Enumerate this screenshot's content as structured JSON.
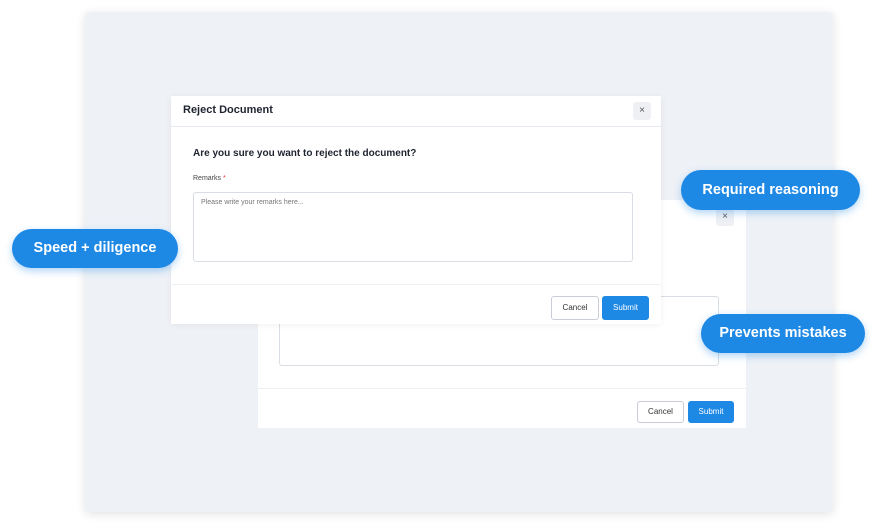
{
  "back_modal": {
    "cancel_label": "Cancel",
    "submit_label": "Submit",
    "close_glyph": "×"
  },
  "modal": {
    "title": "Reject Document",
    "close_glyph": "×",
    "question": "Are you sure you want to reject the document?",
    "remarks_label": "Remarks",
    "required_marker": "*",
    "remarks_placeholder": "Please write your remarks here...",
    "remarks_value": "",
    "cancel_label": "Cancel",
    "submit_label": "Submit"
  },
  "callouts": {
    "speed": "Speed + diligence",
    "required": "Required reasoning",
    "prevents": "Prevents mistakes"
  },
  "colors": {
    "accent": "#1e88e5",
    "panel_bg": "#eef1f6"
  }
}
